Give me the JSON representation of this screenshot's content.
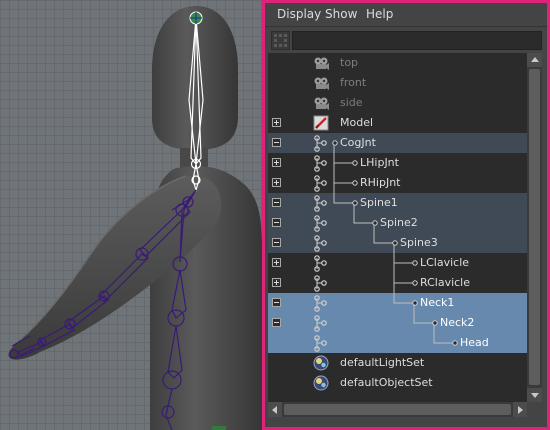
{
  "menu": [
    "Display",
    "Show",
    "Help"
  ],
  "filter": {
    "value": ""
  },
  "tree": [
    {
      "label": "top",
      "icon": "camera-icon",
      "dimmed": true,
      "depth": 0,
      "expander": null,
      "state": "normal"
    },
    {
      "label": "front",
      "icon": "camera-icon",
      "dimmed": true,
      "depth": 0,
      "expander": null,
      "state": "normal"
    },
    {
      "label": "side",
      "icon": "camera-icon",
      "dimmed": true,
      "depth": 0,
      "expander": null,
      "state": "normal"
    },
    {
      "label": "Model",
      "icon": "mesh-icon",
      "dimmed": false,
      "depth": 0,
      "expander": "plus",
      "state": "normal"
    },
    {
      "label": "CogJnt",
      "icon": "joint-icon",
      "dimmed": false,
      "depth": 0,
      "expander": "minus",
      "state": "group"
    },
    {
      "label": "LHipJnt",
      "icon": "joint-icon",
      "dimmed": false,
      "depth": 1,
      "expander": "plus",
      "state": "normal"
    },
    {
      "label": "RHipJnt",
      "icon": "joint-icon",
      "dimmed": false,
      "depth": 1,
      "expander": "plus",
      "state": "normal"
    },
    {
      "label": "Spine1",
      "icon": "joint-icon",
      "dimmed": false,
      "depth": 1,
      "expander": "minus",
      "state": "group"
    },
    {
      "label": "Spine2",
      "icon": "joint-icon",
      "dimmed": false,
      "depth": 2,
      "expander": "minus",
      "state": "group"
    },
    {
      "label": "Spine3",
      "icon": "joint-icon",
      "dimmed": false,
      "depth": 3,
      "expander": "minus",
      "state": "group"
    },
    {
      "label": "LClavicle",
      "icon": "joint-icon",
      "dimmed": false,
      "depth": 4,
      "expander": "plus",
      "state": "normal"
    },
    {
      "label": "RClavicle",
      "icon": "joint-icon",
      "dimmed": false,
      "depth": 4,
      "expander": "plus",
      "state": "normal"
    },
    {
      "label": "Neck1",
      "icon": "joint-icon",
      "dimmed": false,
      "depth": 4,
      "expander": "minus",
      "state": "selected"
    },
    {
      "label": "Neck2",
      "icon": "joint-icon",
      "dimmed": false,
      "depth": 5,
      "expander": "minus",
      "state": "selected"
    },
    {
      "label": "Head",
      "icon": "joint-icon",
      "dimmed": false,
      "depth": 6,
      "expander": null,
      "state": "selected"
    },
    {
      "label": "defaultLightSet",
      "icon": "set-icon",
      "dimmed": false,
      "depth": 0,
      "expander": null,
      "state": "normal"
    },
    {
      "label": "defaultObjectSet",
      "icon": "set-icon",
      "dimmed": false,
      "depth": 0,
      "expander": null,
      "state": "normal"
    }
  ],
  "colors": {
    "window_border": "#e0237a",
    "selection": "#6789ae",
    "group_highlight": "#3f4a56",
    "skeleton": "#3a1a78",
    "wireframe": "#ffffff"
  }
}
